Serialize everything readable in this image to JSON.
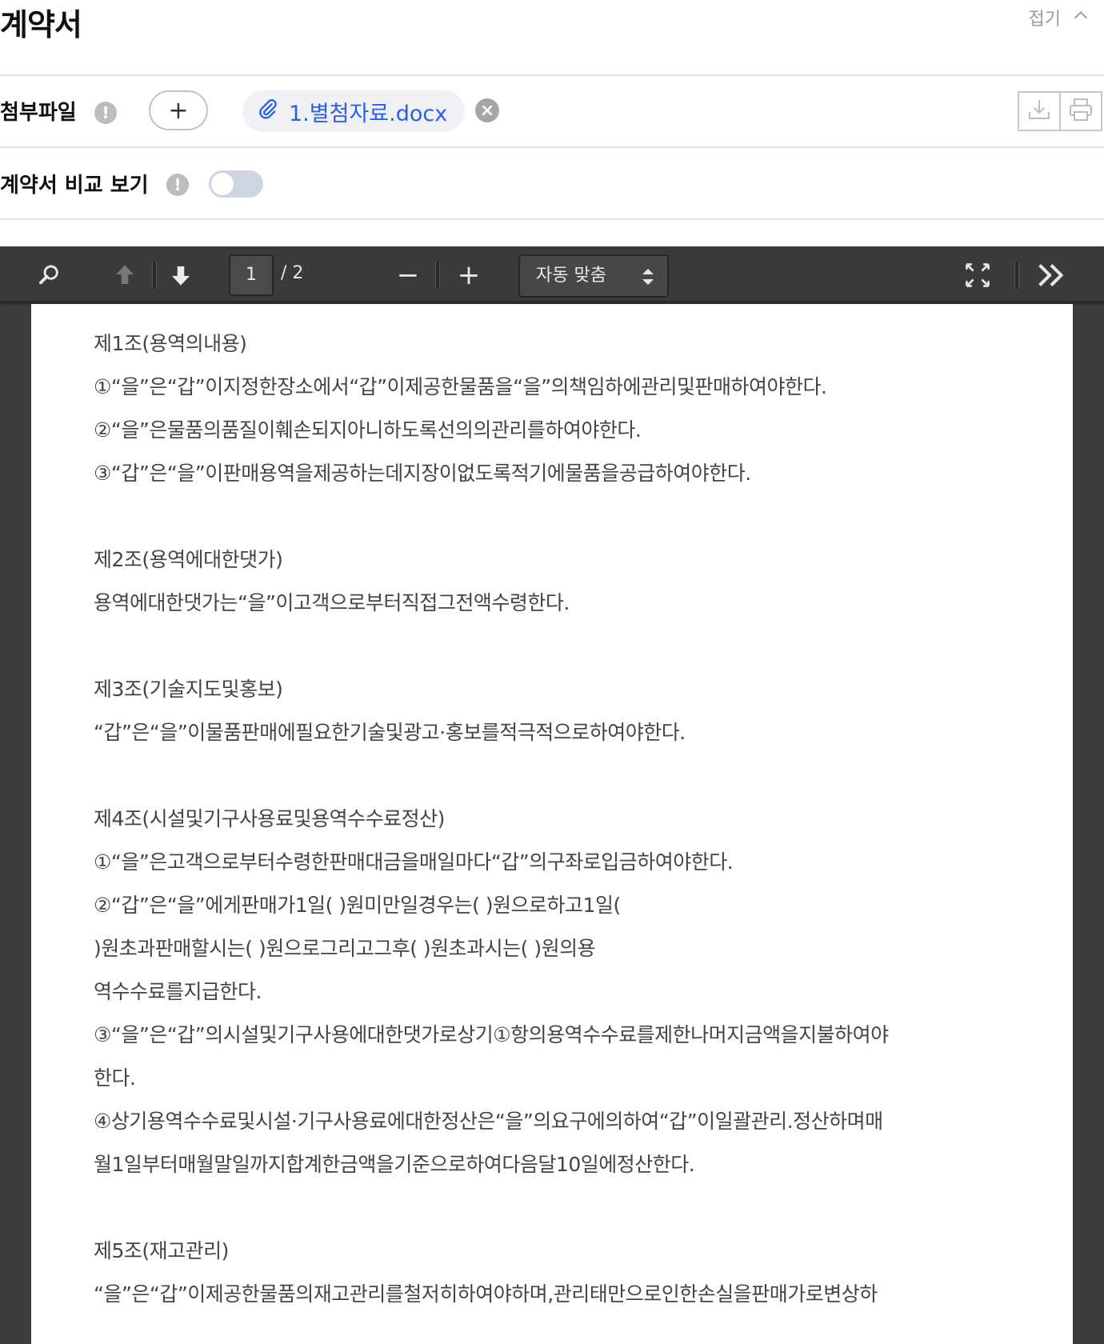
{
  "header": {
    "title": "계약서",
    "collapse_label": "접기"
  },
  "attachment": {
    "label": "첨부파일",
    "info_glyph": "!",
    "add_glyph": "+",
    "file_name": "1.별첨자료.docx",
    "remove_glyph": "×",
    "icons": [
      "download-icon",
      "print-icon"
    ]
  },
  "compare": {
    "label": "계약서 비교 보기",
    "info_glyph": "!",
    "enabled": false
  },
  "viewer": {
    "page_current": "1",
    "page_total": "/ 2",
    "zoom_in_glyph": "+",
    "zoom_out_glyph": "−",
    "zoom_value": "자동 맞춤",
    "icons": [
      "search-icon",
      "page-up-icon",
      "page-down-icon",
      "fullscreen-icon",
      "more-icon"
    ]
  },
  "document": {
    "lines": [
      "제1조(용역의내용)",
      "①“을”은“갑”이지정한장소에서“갑”이제공한물품을“을”의책임하에관리및판매하여야한다.",
      "②“을”은물품의품질이훼손되지아니하도록선의의관리를하여야한다.",
      "③“갑”은“을”이판매용역을제공하는데지장이없도록적기에물품을공급하여야한다.",
      "",
      "제2조(용역에대한댓가)",
      "용역에대한댓가는“을”이고객으로부터직접그전액수령한다.",
      "",
      "제3조(기술지도및홍보)",
      "“갑”은“을”이물품판매에필요한기술및광고·홍보를적극적으로하여야한다.",
      "",
      "제4조(시설및기구사용료및용역수수료정산)",
      "①“을”은고객으로부터수령한판매대금을매일마다“갑”의구좌로입금하여야한다.",
      "②“갑”은“을”에게판매가1일(                    )원미만일경우는(                      )원으로하고1일(",
      ")원초과판매할시는(                    )원으로그리고그후(                      )원초과시는(                         )원의용",
      "역수수료를지급한다.",
      "③“을”은“갑”의시설및기구사용에대한댓가로상기①항의용역수수료를제한나머지금액을지불하여야",
      "한다.",
      "④상기용역수수료및시설·기구사용료에대한정산은“을”의요구에의하여“갑”이일괄관리.정산하며매",
      "월1일부터매월말일까지합계한금액을기준으로하여다음달10일에정산한다.",
      "",
      "제5조(재고관리)",
      "“을”은“갑”이제공한물품의재고관리를철저히하여야하며,관리태만으로인한손실을판매가로변상하"
    ]
  }
}
